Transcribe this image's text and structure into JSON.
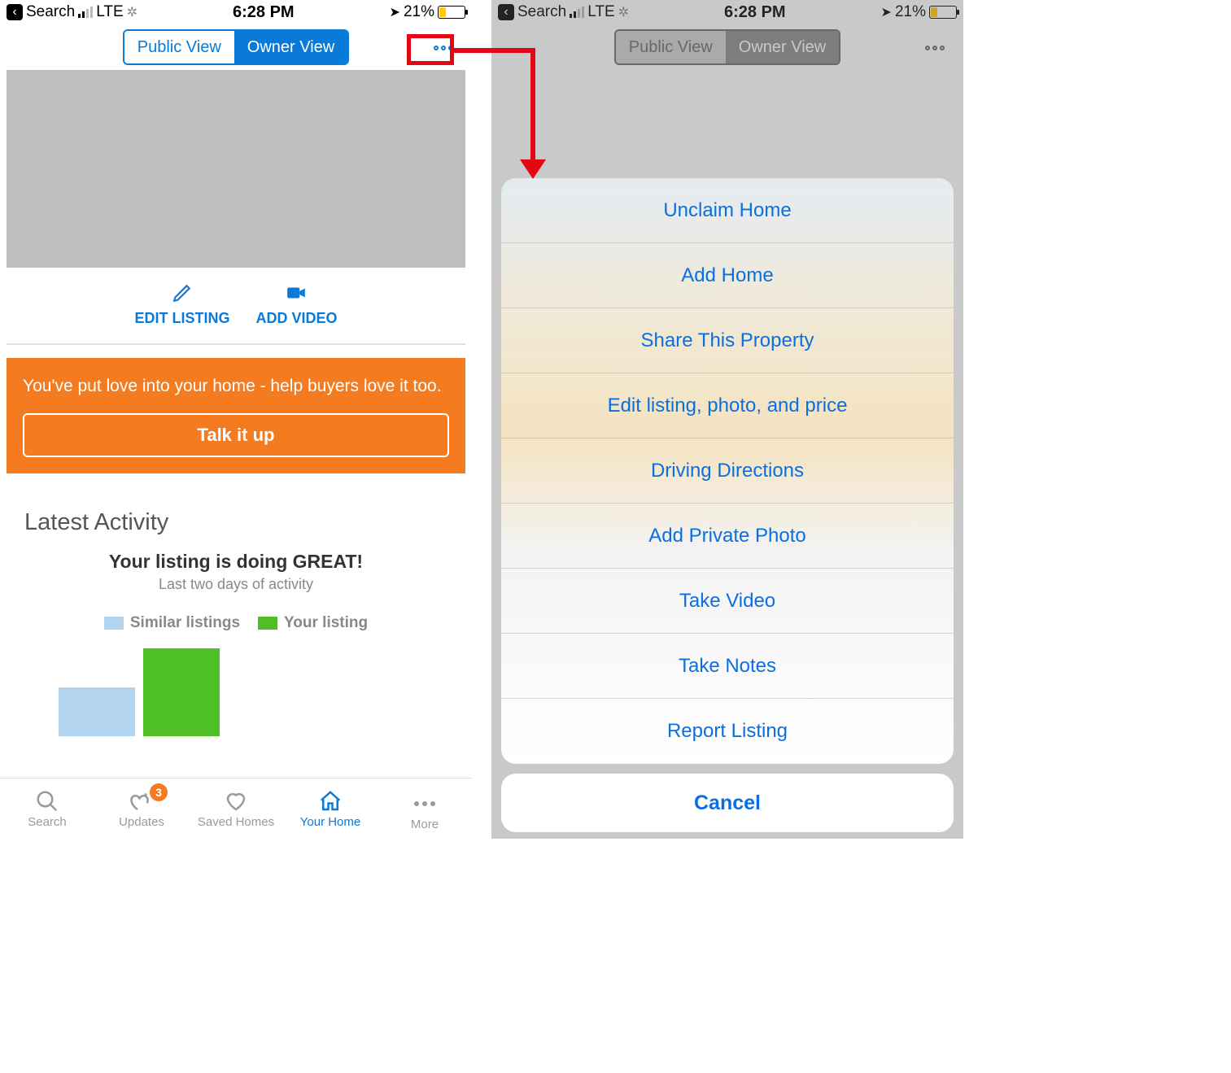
{
  "status_bar": {
    "back_label": "Search",
    "carrier_label": "LTE",
    "time": "6:28 PM",
    "battery_pct": "21%"
  },
  "navbar": {
    "segment_public": "Public View",
    "segment_owner": "Owner View"
  },
  "actions": {
    "edit_label": "EDIT LISTING",
    "video_label": "ADD VIDEO"
  },
  "promo": {
    "text": "You've put love into your home - help buyers love it too.",
    "cta": "Talk it up"
  },
  "activity": {
    "heading": "Latest Activity",
    "title": "Your listing is doing GREAT!",
    "subtitle": "Last two days of activity",
    "legend_similar": "Similar listings",
    "legend_yours": "Your listing"
  },
  "chart_data": {
    "type": "bar",
    "categories": [
      "Similar listings",
      "Your listing"
    ],
    "values": [
      55,
      100
    ],
    "title": "Your listing is doing GREAT!",
    "subtitle": "Last two days of activity",
    "xlabel": "",
    "ylabel": "",
    "note": "Axis values are not labeled in the screenshot; values are relative bar heights (0-100)."
  },
  "tabs": {
    "search": "Search",
    "updates": "Updates",
    "updates_badge": "3",
    "saved": "Saved Homes",
    "your_home": "Your Home",
    "more": "More"
  },
  "action_sheet": {
    "items": [
      "Unclaim Home",
      "Add Home",
      "Share This Property",
      "Edit listing, photo, and price",
      "Driving Directions",
      "Add Private Photo",
      "Take Video",
      "Take Notes",
      "Report Listing"
    ],
    "cancel": "Cancel"
  }
}
